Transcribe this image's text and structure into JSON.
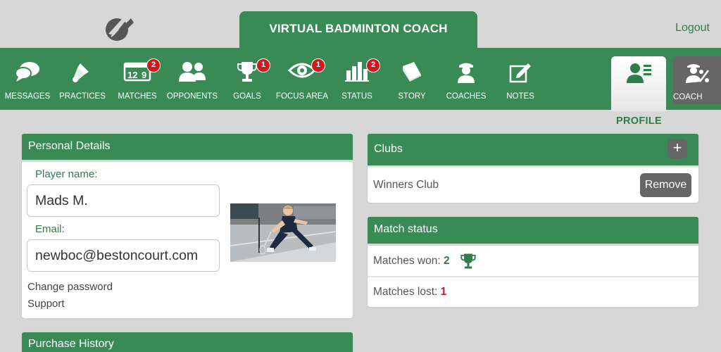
{
  "header": {
    "app_title": "VIRTUAL BADMINTON COACH",
    "logout_label": "Logout",
    "logo_icon": "shuttlecock-logo-icon"
  },
  "nav": {
    "items": [
      {
        "label": "MESSAGES",
        "icon": "speech-bubble-icon",
        "badge": ""
      },
      {
        "label": "PRACTICES",
        "icon": "shuttlecock-icon",
        "badge": ""
      },
      {
        "label": "MATCHES",
        "icon": "calendar-icon",
        "badge": "2"
      },
      {
        "label": "OPPONENTS",
        "icon": "users-icon",
        "badge": ""
      },
      {
        "label": "GOALS",
        "icon": "trophy-icon",
        "badge": "1"
      },
      {
        "label": "FOCUS AREA",
        "icon": "eye-icon",
        "badge": "1"
      },
      {
        "label": "STATUS",
        "icon": "bar-chart-icon",
        "badge": "2"
      },
      {
        "label": "STORY",
        "icon": "book-icon",
        "badge": ""
      },
      {
        "label": "COACHES",
        "icon": "coach-icon",
        "badge": ""
      },
      {
        "label": "NOTES",
        "icon": "note-edit-icon",
        "badge": ""
      }
    ],
    "profile_label": "PROFILE",
    "coach_label": "COACH"
  },
  "personal": {
    "title": "Personal Details",
    "name_label": "Player name:",
    "name_value": "Mads M.",
    "email_label": "Email:",
    "email_value": "newboc@bestoncourt.com",
    "change_password": "Change password",
    "support": "Support"
  },
  "purchase": {
    "title": "Purchase History"
  },
  "clubs": {
    "title": "Clubs",
    "add_symbol": "+",
    "items": [
      {
        "name": "Winners Club",
        "action": "Remove"
      }
    ]
  },
  "match_status": {
    "title": "Match status",
    "won_label": "Matches won:",
    "won_value": "2",
    "lost_label": "Matches lost:",
    "lost_value": "1"
  },
  "colors": {
    "brand_green": "#3a8a55",
    "badge_red": "#d0181e",
    "background": "#d7d7d7"
  }
}
